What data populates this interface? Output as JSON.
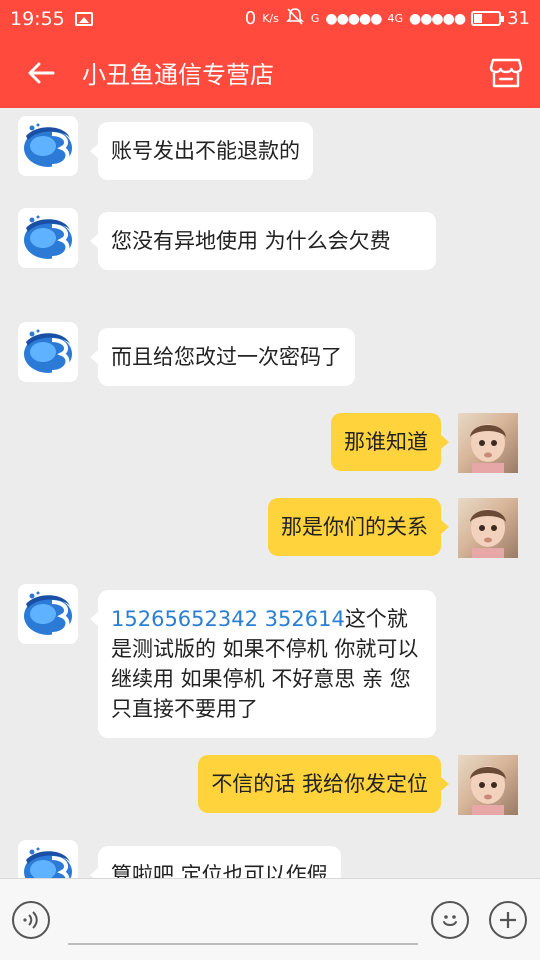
{
  "status_bar": {
    "time": "19:55",
    "speed": "0",
    "speed_unit": "K/s",
    "network_g": "G",
    "network_4g": "4G",
    "signal_dots": "●●●●●",
    "battery_text": "31",
    "battery_level": 0.31
  },
  "header": {
    "title": "小丑鱼通信专营店"
  },
  "messages": [
    {
      "side": "in",
      "text": "账号发出不能退款的"
    },
    {
      "side": "in",
      "text": "您没有异地使用 为什么会欠费"
    },
    {
      "side": "in",
      "text": "而且给您改过一次密码了"
    },
    {
      "side": "out",
      "text": "那谁知道"
    },
    {
      "side": "out",
      "text": "那是你们的关系"
    },
    {
      "side": "in",
      "link_text": "15265652342 352614",
      "text": "这个就是测试版的  如果不停机 你就可以继续用  如果停机  不好意思 亲 您只直接不要用了"
    },
    {
      "side": "out",
      "text": "不信的话 我给你发定位"
    },
    {
      "side": "in",
      "text": "算啦吧  定位也可以作假"
    }
  ],
  "input_bar": {
    "value": "",
    "placeholder": ""
  },
  "colors": {
    "brand_red": "#ff4a3d",
    "out_bubble": "#ffd33c",
    "in_bubble": "#ffffff",
    "link": "#2a7fd4"
  },
  "icons": {
    "back": "arrow-left-icon",
    "shop": "store-icon",
    "voice": "voice-icon",
    "emoji": "smiley-icon",
    "more": "plus-icon"
  }
}
